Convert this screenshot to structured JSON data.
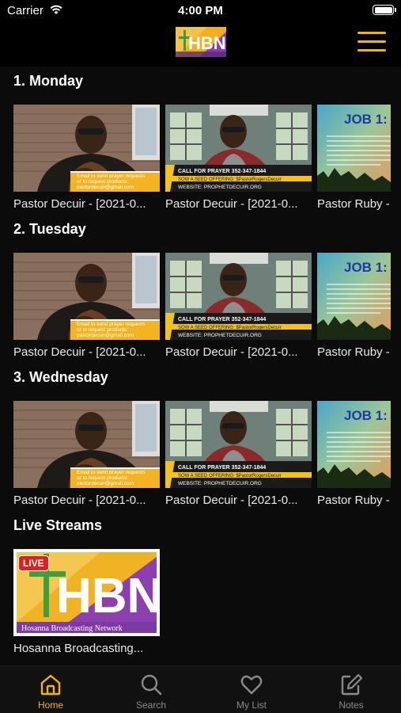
{
  "status": {
    "carrier": "Carrier",
    "time": "4:00 PM"
  },
  "logo_text": "HBN",
  "sections": [
    {
      "title": "1. Monday",
      "items": [
        {
          "title": "Pastor Decuir - [2021-0...",
          "thumb": "pastor-email"
        },
        {
          "title": "Pastor Decuir - [2021-0...",
          "thumb": "pastor-prayer"
        },
        {
          "title": "Pastor Ruby -",
          "thumb": "job-verse"
        }
      ]
    },
    {
      "title": "2. Tuesday",
      "items": [
        {
          "title": "Pastor Decuir - [2021-0...",
          "thumb": "pastor-email"
        },
        {
          "title": "Pastor Decuir - [2021-0...",
          "thumb": "pastor-prayer"
        },
        {
          "title": "Pastor Ruby -",
          "thumb": "job-verse"
        }
      ]
    },
    {
      "title": "3. Wednesday",
      "items": [
        {
          "title": "Pastor Decuir - [2021-0...",
          "thumb": "pastor-email"
        },
        {
          "title": "Pastor Decuir - [2021-0...",
          "thumb": "pastor-prayer"
        },
        {
          "title": "Pastor Ruby -",
          "thumb": "job-verse"
        }
      ]
    }
  ],
  "live": {
    "title": "Live Streams",
    "badge": "LIVE",
    "logo_letters": "HBN",
    "logo_caption": "Hosanna Broadcasting Network",
    "item_title": "Hosanna Broadcasting..."
  },
  "thumb_text": {
    "email_line1": "Email to send prayer requests",
    "email_line2": "or to request products:",
    "email_line3": "pastordecuir@gmail.com",
    "prayer_line1": "CALL FOR PRAYER 352-347-1844",
    "prayer_line2": "SOW A SEED OFFERING: $PastorRogersDecuir",
    "prayer_line3": "WEBSITE: PROPHETDECUIR.ORG",
    "job": "JOB 1:"
  },
  "tabs": [
    {
      "label": "Home",
      "icon": "home-icon",
      "active": true
    },
    {
      "label": "Search",
      "icon": "search-icon",
      "active": false
    },
    {
      "label": "My List",
      "icon": "heart-icon",
      "active": false
    },
    {
      "label": "Notes",
      "icon": "notes-icon",
      "active": false
    }
  ],
  "colors": {
    "accent": "#f2b600",
    "background": "#0b0b0b",
    "live": "#e02020"
  }
}
